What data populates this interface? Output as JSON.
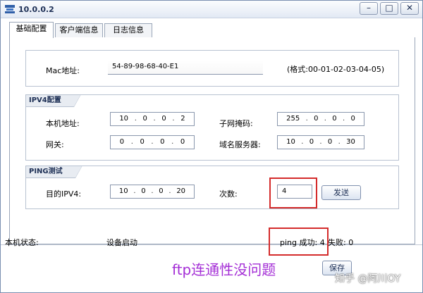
{
  "window": {
    "title": "10.0.0.2"
  },
  "tabs": [
    {
      "label": "基础配置",
      "active": true
    },
    {
      "label": "客户端信息",
      "active": false
    },
    {
      "label": "日志信息",
      "active": false
    }
  ],
  "mac": {
    "label": "Mac地址:",
    "value": "54-89-98-68-40-E1",
    "format_hint": "(格式:00-01-02-03-04-05)"
  },
  "ipv4": {
    "section_label": "IPV4配置",
    "local_ip_label": "本机地址:",
    "local_ip": [
      "10",
      "0",
      "0",
      "2"
    ],
    "mask_label": "子网掩码:",
    "mask": [
      "255",
      "0",
      "0",
      "0"
    ],
    "gateway_label": "网关:",
    "gateway": [
      "0",
      "0",
      "0",
      "0"
    ],
    "dns_label": "域名服务器:",
    "dns": [
      "10",
      "0",
      "0",
      "30"
    ]
  },
  "ping": {
    "section_label": "PING测试",
    "dest_label": "目的IPV4:",
    "dest": [
      "10",
      "0",
      "0",
      "20"
    ],
    "count_label": "次数:",
    "count": "4",
    "send_label": "发送"
  },
  "status": {
    "label": "本机状态:",
    "value": "设备启动",
    "ping_success": "ping 成功: 4",
    "fail": "失败: 0"
  },
  "save_label": "保存",
  "annotation": "ftp连通性没问题",
  "watermark": "知乎 @阿川OY",
  "colors": {
    "highlight": "#d42b2b",
    "annotation": "#a42ed6",
    "titlebar": "#e2e9f4"
  }
}
